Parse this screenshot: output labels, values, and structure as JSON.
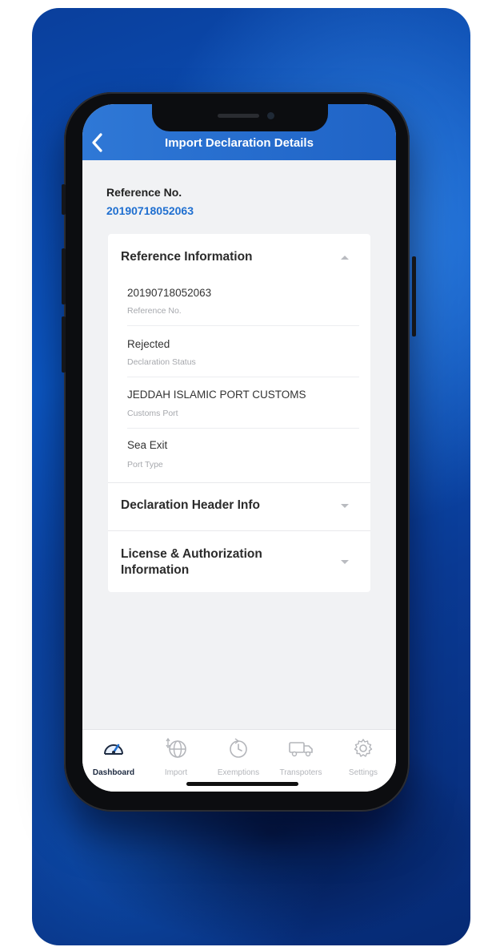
{
  "header": {
    "title": "Import Declaration Details"
  },
  "reference": {
    "label": "Reference No.",
    "value": "20190718052063"
  },
  "sections": [
    {
      "title": "Reference Information",
      "expanded": true,
      "fields": [
        {
          "value": "20190718052063",
          "label": "Reference No."
        },
        {
          "value": "Rejected",
          "label": "Declaration Status"
        },
        {
          "value": "JEDDAH ISLAMIC PORT CUSTOMS",
          "label": "Customs Port"
        },
        {
          "value": "Sea Exit",
          "label": "Port Type"
        }
      ]
    },
    {
      "title": "Declaration Header Info",
      "expanded": false
    },
    {
      "title": "License & Authorization Information",
      "expanded": false
    }
  ],
  "nav": [
    {
      "label": "Dashboard",
      "icon": "speedometer-icon",
      "active": true
    },
    {
      "label": "Import",
      "icon": "globe-import-icon",
      "active": false
    },
    {
      "label": "Exemptions",
      "icon": "clock-refresh-icon",
      "active": false
    },
    {
      "label": "Transpoters",
      "icon": "truck-icon",
      "active": false
    },
    {
      "label": "Settings",
      "icon": "gear-icon",
      "active": false
    }
  ],
  "colors": {
    "accent": "#1f6fd0",
    "header": "#2a72d3",
    "background": "#0b4fb5"
  }
}
